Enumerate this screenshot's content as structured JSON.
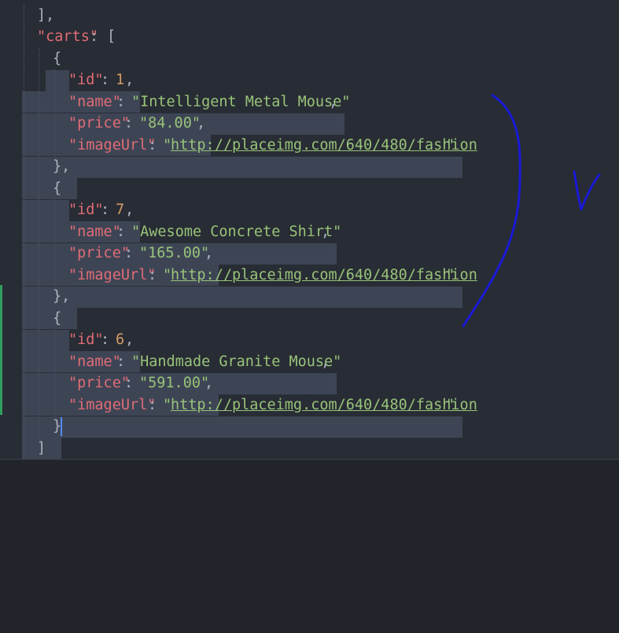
{
  "editor": {
    "colors": {
      "background": "#282c34",
      "selection": "#3d4555",
      "key": "#e06c75",
      "string": "#98c379",
      "number": "#d19a66",
      "punctuation": "#abb2bf",
      "cursor": "#528bff",
      "git_added": "#2f9e5f",
      "annotation_ink": "#1a1ad6"
    },
    "lines": {
      "l01": {
        "close": "]",
        "comma": ","
      },
      "l02": {
        "key": "\"carts\"",
        "colon": ":",
        "open": "["
      },
      "l03": {
        "brace": "{"
      },
      "l04": {
        "key": "\"id\"",
        "colon": ":",
        "value": "1",
        "comma": ","
      },
      "l05": {
        "key": "\"name\"",
        "colon": ":",
        "value": "\"Intelligent Metal Mouse\"",
        "comma": ","
      },
      "l06": {
        "key": "\"price\"",
        "colon": ":",
        "value": "\"84.00\"",
        "comma": ","
      },
      "l07": {
        "key": "\"imageUrl\"",
        "colon": ":",
        "q1": "\"",
        "url": "http://placeimg.com/640/480/fashion",
        "q2": "\""
      },
      "l08": {
        "brace": "}",
        "comma": ","
      },
      "l09": {
        "brace": "{"
      },
      "l10": {
        "key": "\"id\"",
        "colon": ":",
        "value": "7",
        "comma": ","
      },
      "l11": {
        "key": "\"name\"",
        "colon": ":",
        "value": "\"Awesome Concrete Shirt\"",
        "comma": ","
      },
      "l12": {
        "key": "\"price\"",
        "colon": ":",
        "value": "\"165.00\"",
        "comma": ","
      },
      "l13": {
        "key": "\"imageUrl\"",
        "colon": ":",
        "q1": "\"",
        "url": "http://placeimg.com/640/480/fashion",
        "q2": "\""
      },
      "l14": {
        "brace": "}",
        "comma": ","
      },
      "l15": {
        "brace": "{"
      },
      "l16": {
        "key": "\"id\"",
        "colon": ":",
        "value": "6",
        "comma": ","
      },
      "l17": {
        "key": "\"name\"",
        "colon": ":",
        "value": "\"Handmade Granite Mouse\"",
        "comma": ","
      },
      "l18": {
        "key": "\"price\"",
        "colon": ":",
        "value": "\"591.00\"",
        "comma": ","
      },
      "l19": {
        "key": "\"imageUrl\"",
        "colon": ":",
        "q1": "\"",
        "url": "http://placeimg.com/640/480/fashion",
        "q2": "\""
      },
      "l20": {
        "brace": "}"
      },
      "l21": {
        "close": "]"
      }
    }
  }
}
